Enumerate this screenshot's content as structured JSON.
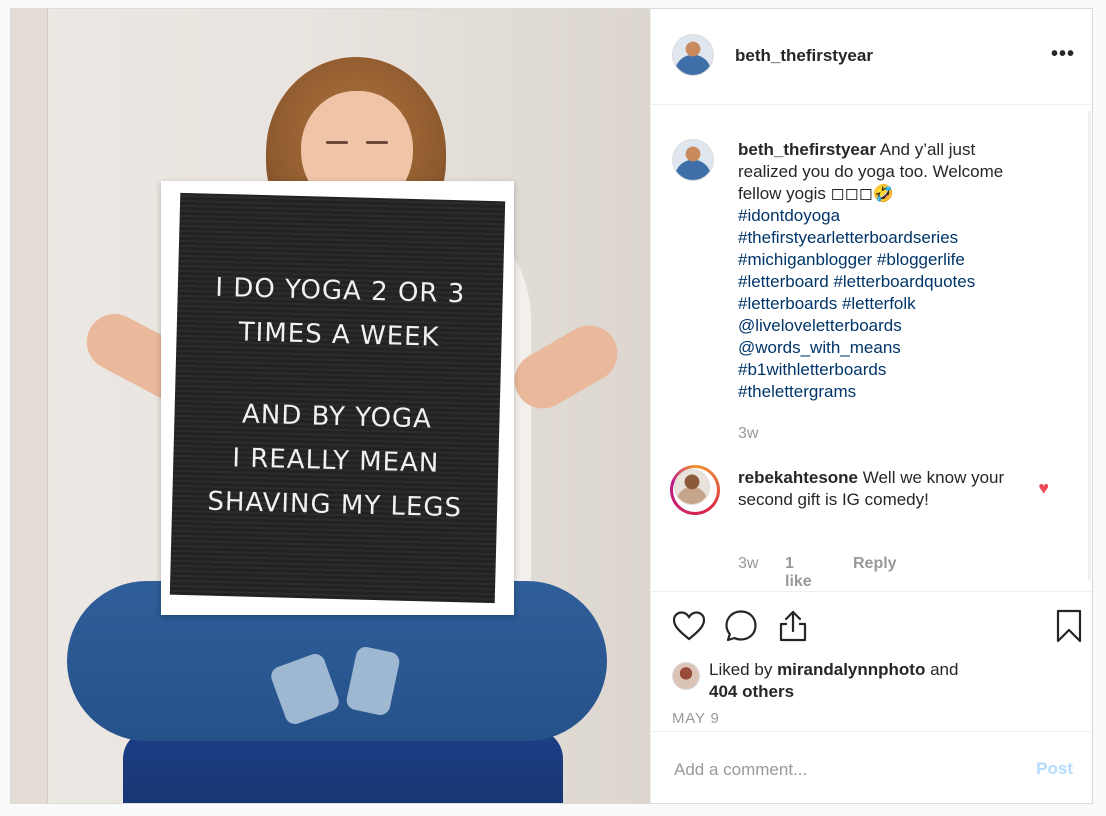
{
  "post": {
    "author": "beth_thefirstyear",
    "more_icon": "more-options-icon",
    "image": {
      "letterboard_lines": [
        "I DO YOGA 2 OR 3",
        "TIMES A WEEK",
        "",
        "AND BY YOGA",
        "I REALLY MEAN",
        "SHAVING MY LEGS"
      ]
    }
  },
  "caption": {
    "username": "beth_thefirstyear",
    "text": "And y’all just realized you do yoga too. Welcome fellow yogis ◻◻◻🤣",
    "hashtags": [
      "#idontdoyoga",
      "#thefirstyearletterboardseries",
      "#michiganblogger #bloggerlife",
      "#letterboard #letterboardquotes",
      "#letterboards #letterfolk",
      "@liveloveletterboards",
      "@words_with_means",
      "#b1withletterboards",
      "#thelettergrams"
    ],
    "time": "3w"
  },
  "comment": {
    "username": "rebekahtesone",
    "text": "Well we know your second gift is IG comedy!",
    "time": "3w",
    "likes": "1 like",
    "reply": "Reply"
  },
  "actions": {
    "like": "heart-icon",
    "comment": "comment-icon",
    "share": "share-icon",
    "save": "bookmark-icon"
  },
  "likes": {
    "prefix": "Liked by",
    "user": "mirandalynnphoto",
    "and": "and",
    "others": "404 others"
  },
  "date": "MAY 9",
  "add_comment": {
    "placeholder": "Add a comment...",
    "post_label": "Post"
  },
  "colors": {
    "link": "#003569",
    "like_heart": "#ed4956",
    "post_disabled": "#b3dbff",
    "muted": "#999999"
  }
}
